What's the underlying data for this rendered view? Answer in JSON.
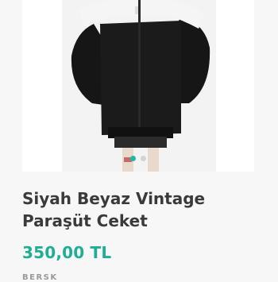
{
  "product": {
    "title_line1": "Siyah Beyaz Vintage",
    "title_line2": "Paraşüt Ceket",
    "price": "350,00 TL",
    "brand": "BERSK"
  },
  "gallery": {
    "slide_count": 2,
    "active_index": 0
  },
  "colors": {
    "accent": "#1fae94",
    "title": "#3a3a3a",
    "background": "#f7f7f8"
  }
}
